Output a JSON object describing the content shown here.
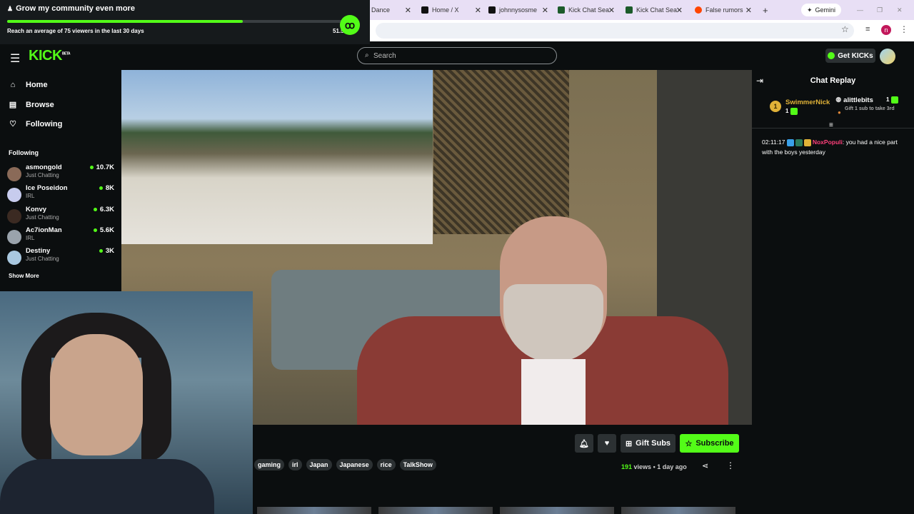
{
  "goal": {
    "title": "Grow my community even more",
    "description": "Reach an average of 75 viewers in the last 30 days",
    "percent_label": "51.5",
    "progress": 0.69
  },
  "browser": {
    "tabs": [
      {
        "label": "Dance",
        "icon": "dance-tab-icon"
      },
      {
        "label": "Home / X",
        "icon": "x-logo-icon"
      },
      {
        "label": "johnnysosme",
        "icon": "x-logo-icon"
      },
      {
        "label": "Kick Chat Sea",
        "icon": "kick-tab-icon"
      },
      {
        "label": "Kick Chat Sea",
        "icon": "kick-tab-icon"
      },
      {
        "label": "False rumors",
        "icon": "reddit-icon"
      }
    ],
    "gemini_label": "Gemini",
    "profile_initial": "n"
  },
  "header": {
    "logo": "KICK",
    "logo_sup": "BETA",
    "search_placeholder": "Search",
    "get_kicks_label": "Get KICKs"
  },
  "sidebar": {
    "nav": [
      {
        "label": "Home",
        "icon": "home-icon"
      },
      {
        "label": "Browse",
        "icon": "browse-icon"
      },
      {
        "label": "Following",
        "icon": "heart-icon"
      }
    ],
    "following_heading": "Following",
    "channels": [
      {
        "name": "asmongold",
        "category": "Just Chatting",
        "viewers": "10.7K",
        "color": "#8a6a58"
      },
      {
        "name": "Ice Poseidon",
        "category": "IRL",
        "viewers": "8K",
        "color": "#c7ccee"
      },
      {
        "name": "Konvy",
        "category": "Just Chatting",
        "viewers": "6.3K",
        "color": "#3b2a22"
      },
      {
        "name": "Ac7ionMan",
        "category": "IRL",
        "viewers": "5.6K",
        "color": "#9aa3ac"
      },
      {
        "name": "Destiny",
        "category": "Just Chatting",
        "viewers": "3K",
        "color": "#a9c8e0"
      }
    ],
    "show_more": "Show More"
  },
  "controls": {
    "gift_subs_label": "Gift Subs",
    "subscribe_label": "Subscribe",
    "tags": [
      "gaming",
      "irl",
      "Japan",
      "Japanese",
      "rice",
      "TalkShow"
    ],
    "views_count": "191",
    "views_label": "views",
    "separator": "•",
    "age": "1 day ago"
  },
  "chat": {
    "title": "Chat Replay",
    "top_gifter": {
      "rank": "1",
      "name": "SwimmerNick",
      "count": "1"
    },
    "second_gifter": {
      "name": "alittlebits",
      "count": "1",
      "note": "Gift 1 sub to take 3rd"
    },
    "message": {
      "timestamp": "02:11:17",
      "user": "NoxPopuli",
      "text": ": you had a nice part with the boys yesterday"
    }
  },
  "colors": {
    "accent": "#53fc18",
    "background": "#0b0e0f",
    "chat_username": "#ff3f7a"
  }
}
